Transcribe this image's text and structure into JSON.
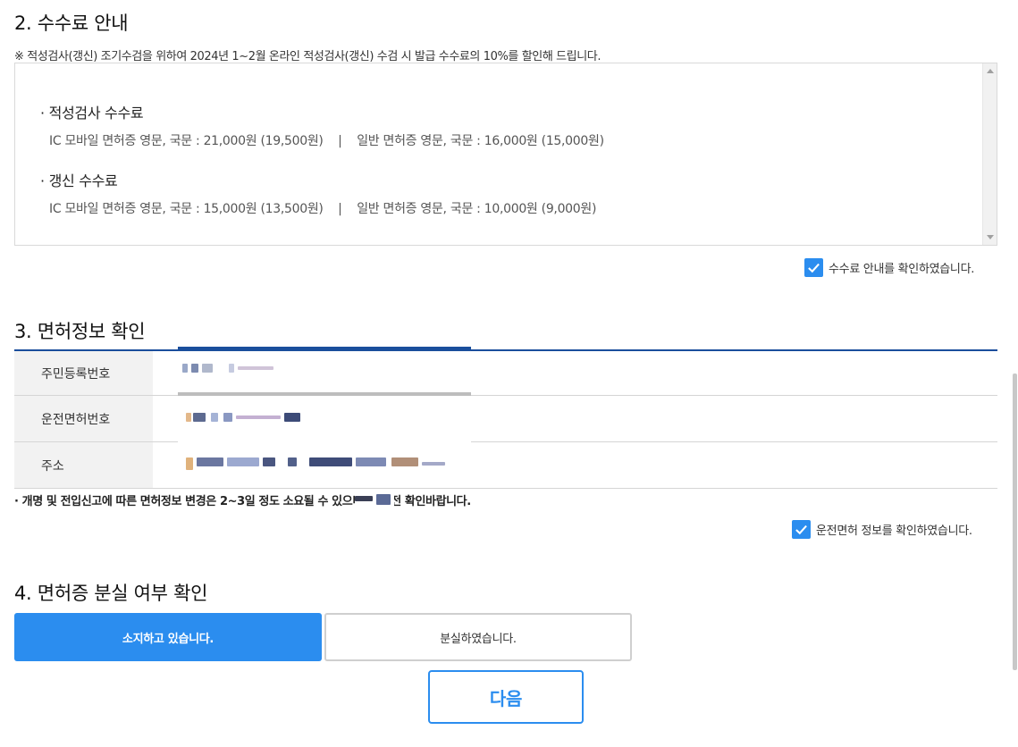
{
  "section2": {
    "title": "2. 수수료 안내",
    "notice": "※ 적성검사(갱신) 조기수검을 위하여 2024년 1~2월 온라인 적성검사(갱신) 수검 시 발급 수수료의 10%를 할인해 드립니다.",
    "aptitude_title": "· 적성검사 수수료",
    "aptitude_line": "IC 모바일 면허증 영문, 국문 : 21,000원 (19,500원)    |    일반 면허증 영문, 국문 : 16,000원 (15,000원)",
    "renewal_title": "· 갱신 수수료",
    "renewal_line": "IC 모바일 면허증 영문, 국문 : 15,000원 (13,500원)    |    일반 면허증 영문, 국문 : 10,000원 (9,000원)",
    "confirm_label": "수수료 안내를 확인하였습니다."
  },
  "section3": {
    "title": "3. 면허정보 확인",
    "rows": [
      {
        "label": "주민등록번호"
      },
      {
        "label": "운전면허번호"
      },
      {
        "label": "주소"
      }
    ],
    "warning": "· 개명 및 전입신고에 따른 면허정보 변경은 2~3일 정도 소요될 수 있으니 신청 전 확인바랍니다.",
    "confirm_label": "운전면허 정보를 확인하였습니다."
  },
  "section4": {
    "title": "4. 면허증 분실 여부 확인",
    "own_button": "소지하고 있습니다.",
    "lost_button": "분실하였습니다."
  },
  "next_button": "다음",
  "colors": {
    "accent": "#2b8def",
    "table_line": "#1a4e9c"
  }
}
